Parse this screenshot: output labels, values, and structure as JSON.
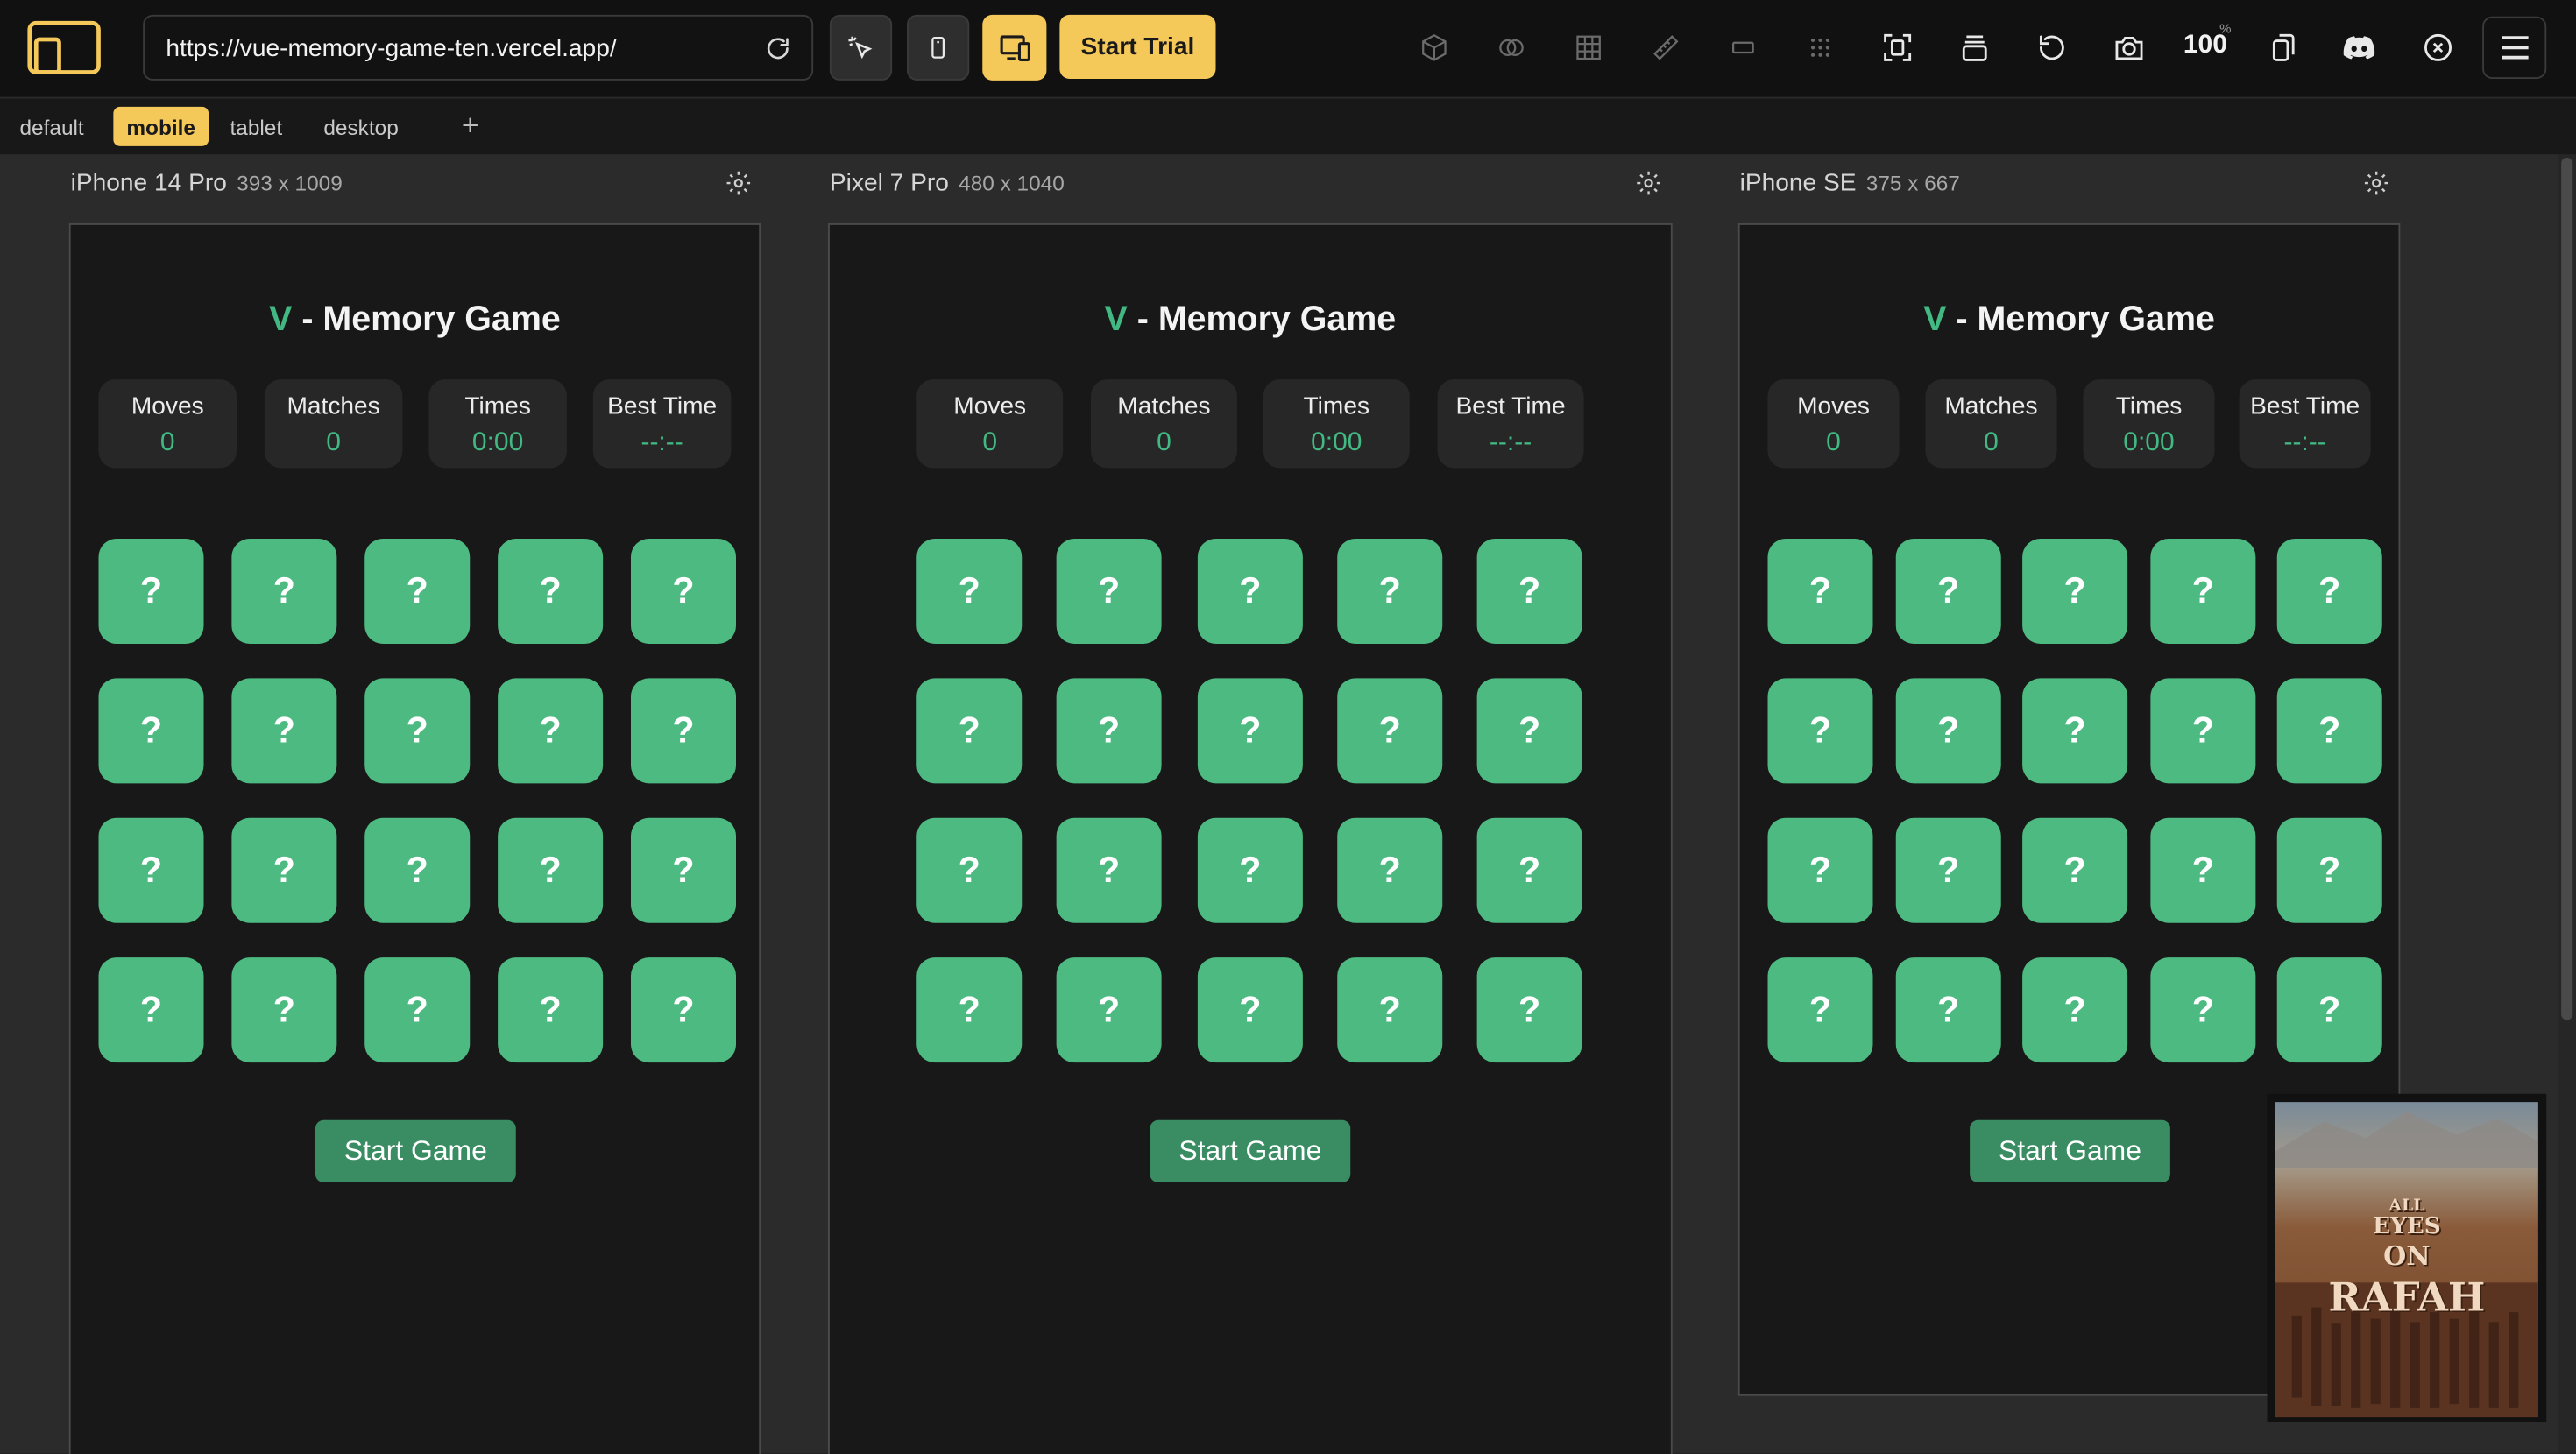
{
  "toolbar": {
    "url": "https://vue-memory-game-ten.vercel.app/",
    "start_trial": "Start Trial",
    "zoom": "100",
    "zoom_unit": "%",
    "accent": "#f5c85a"
  },
  "tabs": [
    {
      "label": "default"
    },
    {
      "label": "mobile"
    },
    {
      "label": "tablet"
    },
    {
      "label": "desktop"
    }
  ],
  "tab_add": "+",
  "devices": [
    {
      "name": "iPhone 14 Pro",
      "dims": "393 x 1009",
      "game": {
        "title_v": "V",
        "title_rest": " - Memory Game",
        "stats": [
          {
            "label": "Moves",
            "value": "0"
          },
          {
            "label": "Matches",
            "value": "0"
          },
          {
            "label": "Times",
            "value": "0:00"
          },
          {
            "label": "Best Time",
            "value": "--:--"
          }
        ],
        "card_face": "?",
        "start": "Start Game"
      }
    },
    {
      "name": "Pixel 7 Pro",
      "dims": "480 x 1040",
      "game": {
        "title_v": "V",
        "title_rest": " - Memory Game",
        "stats": [
          {
            "label": "Moves",
            "value": "0"
          },
          {
            "label": "Matches",
            "value": "0"
          },
          {
            "label": "Times",
            "value": "0:00"
          },
          {
            "label": "Best Time",
            "value": "--:--"
          }
        ],
        "card_face": "?",
        "start": "Start Game"
      }
    },
    {
      "name": "iPhone SE",
      "dims": "375 x 667",
      "game": {
        "title_v": "V",
        "title_rest": " - Memory Game",
        "stats": [
          {
            "label": "Moves",
            "value": "0"
          },
          {
            "label": "Matches",
            "value": "0"
          },
          {
            "label": "Times",
            "value": "0:00"
          },
          {
            "label": "Best Time",
            "value": "--:--"
          }
        ],
        "card_face": "?",
        "start": "Start Game"
      }
    }
  ],
  "poster": {
    "lines": [
      "ALL",
      "EYES",
      "ON",
      "RAFAH"
    ]
  },
  "colors": {
    "vue_green": "#42b883",
    "card_green": "#4dba82",
    "button_green": "#3a8d63"
  }
}
